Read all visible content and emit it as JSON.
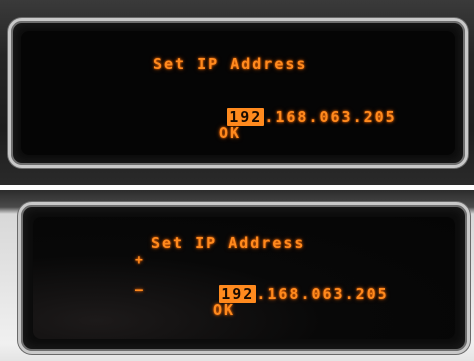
{
  "screens": [
    {
      "title": "Set IP Address",
      "ip": {
        "octets": [
          "192",
          "168",
          "063",
          "205"
        ],
        "separator": ".",
        "selected_index": 0
      },
      "ok_label": "OK"
    },
    {
      "title": "Set IP Address",
      "increment_glyph": "+",
      "decrement_glyph": "–",
      "ip": {
        "octets": [
          "192",
          "168",
          "063",
          "205"
        ],
        "separator": ".",
        "selected_index": 0
      },
      "ok_label": "OK"
    }
  ],
  "colors": {
    "oled_text": "#ff8a1e",
    "selected_background": "#ff8a1e",
    "screen_background": "#050505"
  }
}
